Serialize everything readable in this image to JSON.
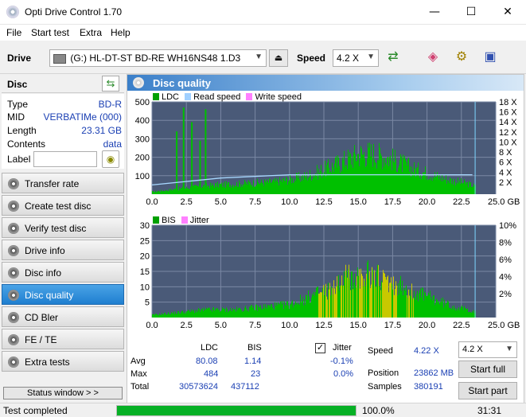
{
  "window": {
    "title": "Opti Drive Control 1.70",
    "minimize": "—",
    "maximize": "☐",
    "close": "✕"
  },
  "menu": [
    "File",
    "Start test",
    "Extra",
    "Help"
  ],
  "toolbar": {
    "drive_label": "Drive",
    "drive_value": "(G:)  HL-DT-ST BD-RE  WH16NS48 1.D3",
    "speed_label": "Speed",
    "speed_value": "4.2 X"
  },
  "disc": {
    "header": "Disc",
    "rows": [
      {
        "key": "Type",
        "value": "BD-R"
      },
      {
        "key": "MID",
        "value": "VERBATIMe (000)"
      },
      {
        "key": "Length",
        "value": "23.31 GB"
      },
      {
        "key": "Contents",
        "value": "data"
      }
    ],
    "label_key": "Label",
    "label_value": ""
  },
  "nav": [
    {
      "label": "Transfer rate",
      "active": false
    },
    {
      "label": "Create test disc",
      "active": false
    },
    {
      "label": "Verify test disc",
      "active": false
    },
    {
      "label": "Drive info",
      "active": false
    },
    {
      "label": "Disc info",
      "active": false
    },
    {
      "label": "Disc quality",
      "active": true
    },
    {
      "label": "CD Bler",
      "active": false
    },
    {
      "label": "FE / TE",
      "active": false
    },
    {
      "label": "Extra tests",
      "active": false
    }
  ],
  "status_window": "Status window > >",
  "panel_title": "Disc quality",
  "legend_top": {
    "ldc": "LDC",
    "read": "Read speed",
    "write": "Write speed"
  },
  "legend_bottom": {
    "bis": "BIS",
    "jitter": "Jitter"
  },
  "chart_data": [
    {
      "type": "bar",
      "series": [
        {
          "name": "LDC",
          "color": "#00c000"
        },
        {
          "name": "Read speed",
          "color": "#a0d0ff"
        },
        {
          "name": "Write speed",
          "color": "#ff80ff"
        }
      ],
      "x_ticks": [
        "0.0",
        "2.5",
        "5.0",
        "7.5",
        "10.0",
        "12.5",
        "15.0",
        "17.5",
        "20.0",
        "22.5",
        "25.0 GB"
      ],
      "y_left_ticks": [
        "500",
        "400",
        "300",
        "200",
        "100"
      ],
      "y_right_ticks": [
        "18 X",
        "16 X",
        "14 X",
        "12 X",
        "10 X",
        "8 X",
        "6 X",
        "4 X",
        "2 X"
      ],
      "xlim": [
        0,
        25
      ],
      "ylim": [
        0,
        500
      ],
      "ldc_profile": [
        [
          0,
          15
        ],
        [
          1,
          25
        ],
        [
          2,
          35
        ],
        [
          3,
          45
        ],
        [
          4,
          55
        ],
        [
          5,
          60
        ],
        [
          6,
          65
        ],
        [
          7,
          70
        ],
        [
          8,
          75
        ],
        [
          9,
          80
        ],
        [
          10,
          95
        ],
        [
          11,
          110
        ],
        [
          12,
          140
        ],
        [
          13,
          175
        ],
        [
          14,
          215
        ],
        [
          15,
          255
        ],
        [
          16,
          260
        ],
        [
          17,
          240
        ],
        [
          18,
          200
        ],
        [
          19,
          160
        ],
        [
          20,
          135
        ],
        [
          21,
          105
        ],
        [
          22,
          85
        ],
        [
          23,
          65
        ],
        [
          23.5,
          50
        ]
      ],
      "ldc_spikes": [
        [
          1.8,
          340
        ],
        [
          2.3,
          470
        ],
        [
          2.9,
          390
        ],
        [
          3.5,
          290
        ],
        [
          3.9,
          460
        ]
      ],
      "read_speed_x": [
        [
          0,
          2
        ],
        [
          5,
          3.5
        ],
        [
          10,
          4.2
        ],
        [
          15,
          4.2
        ],
        [
          20,
          4.2
        ],
        [
          23.3,
          4.2
        ]
      ]
    },
    {
      "type": "bar",
      "series": [
        {
          "name": "BIS",
          "color": "#00c000"
        },
        {
          "name": "Jitter",
          "color": "#ff80ff"
        }
      ],
      "x_ticks": [
        "0.0",
        "2.5",
        "5.0",
        "7.5",
        "10.0",
        "12.5",
        "15.0",
        "17.5",
        "20.0",
        "22.5",
        "25.0 GB"
      ],
      "y_left_ticks": [
        "30",
        "25",
        "20",
        "15",
        "10",
        "5"
      ],
      "y_right_ticks": [
        "10%",
        "8%",
        "6%",
        "4%",
        "2%"
      ],
      "xlim": [
        0,
        25
      ],
      "ylim": [
        0,
        30
      ],
      "bis_profile": [
        [
          0,
          1
        ],
        [
          2,
          2
        ],
        [
          4,
          3
        ],
        [
          6,
          3
        ],
        [
          8,
          4
        ],
        [
          10,
          5
        ],
        [
          11,
          7
        ],
        [
          12,
          9
        ],
        [
          13,
          11
        ],
        [
          14,
          15
        ],
        [
          15,
          17
        ],
        [
          16,
          16
        ],
        [
          17,
          14
        ],
        [
          18,
          12
        ],
        [
          19,
          10
        ],
        [
          20,
          8
        ],
        [
          21,
          6
        ],
        [
          22,
          4
        ],
        [
          23,
          3
        ],
        [
          23.5,
          2
        ]
      ]
    }
  ],
  "stats": {
    "col_ldc": "LDC",
    "col_bis": "BIS",
    "rows": [
      {
        "label": "Avg",
        "ldc": "80.08",
        "bis": "1.14",
        "jitter": "-0.1%"
      },
      {
        "label": "Max",
        "ldc": "484",
        "bis": "23",
        "jitter": "0.0%"
      },
      {
        "label": "Total",
        "ldc": "30573624",
        "bis": "437112"
      }
    ],
    "jitter_label": "Jitter",
    "jitter_checked": "✓",
    "speed_label": "Speed",
    "speed_value": "4.22 X",
    "position_label": "Position",
    "position_value": "23862 MB",
    "samples_label": "Samples",
    "samples_value": "380191",
    "speed_select": "4.2 X",
    "start_full": "Start full",
    "start_part": "Start part"
  },
  "statusbar": {
    "text": "Test completed",
    "progress": 100,
    "percent": "100.0%",
    "time": "31:31"
  }
}
